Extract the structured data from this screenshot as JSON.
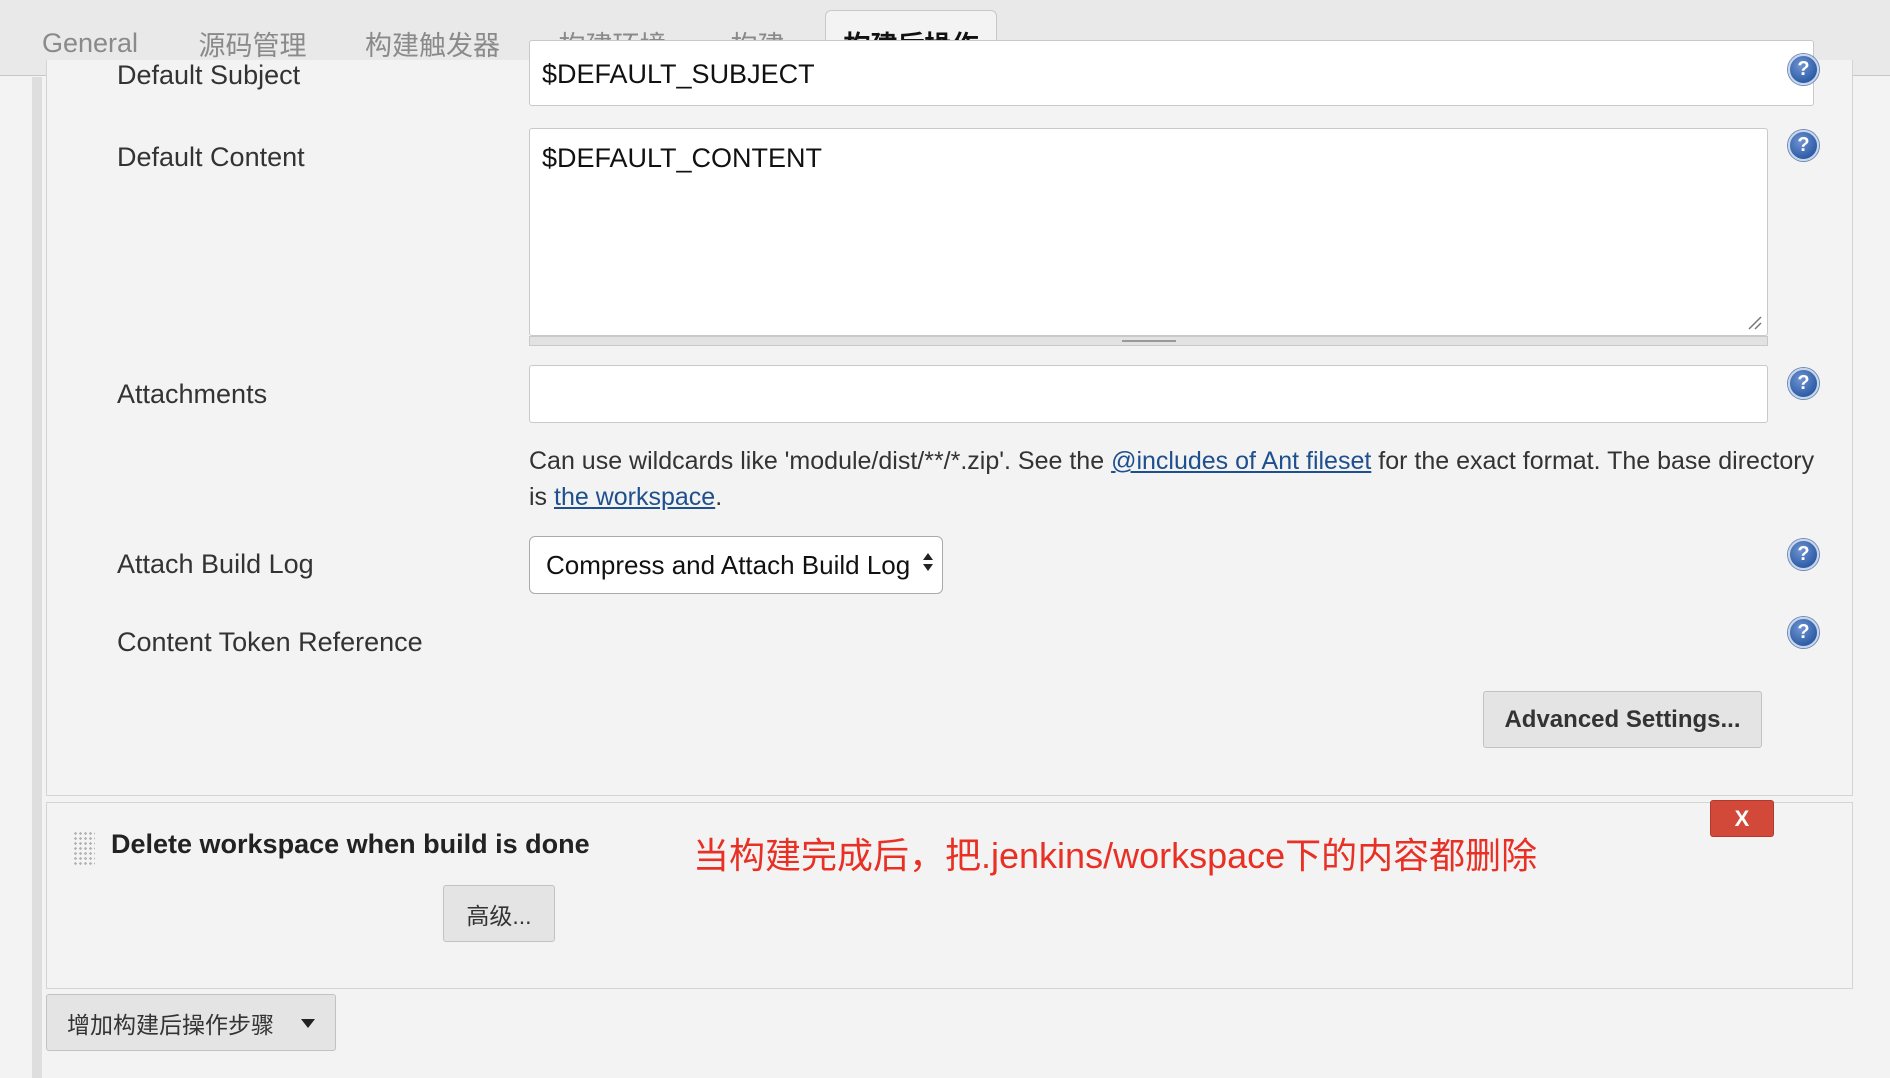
{
  "tabs": [
    {
      "label": "General",
      "active": false
    },
    {
      "label": "源码管理",
      "active": false
    },
    {
      "label": "构建触发器",
      "active": false
    },
    {
      "label": "构建环境",
      "active": false
    },
    {
      "label": "构建",
      "active": false
    },
    {
      "label": "构建后操作",
      "active": true
    }
  ],
  "email": {
    "default_subject_label": "Default Subject",
    "default_subject_value": "$DEFAULT_SUBJECT",
    "default_content_label": "Default Content",
    "default_content_value": "$DEFAULT_CONTENT",
    "attachments_label": "Attachments",
    "attachments_value": "",
    "attachments_hint_prefix": "Can use wildcards like 'module/dist/**/*.zip'. See the ",
    "attachments_hint_link": "@includes of Ant fileset",
    "attachments_hint_mid": " for the exact format. The base directory is ",
    "attachments_hint_link2": "the workspace",
    "attachments_hint_suffix": ".",
    "attach_build_log_label": "Attach Build Log",
    "attach_build_log_value": "Compress and Attach Build Log",
    "content_token_label": "Content Token Reference",
    "advanced_settings_button": "Advanced Settings..."
  },
  "delete_workspace": {
    "title": "Delete workspace when build is done",
    "advanced_button": "高级...",
    "remove_button": "X",
    "annotation": "当构建完成后，把.jenkins/workspace下的内容都删除"
  },
  "add_step_button": "增加构建后操作步骤",
  "colors": {
    "accent_link": "#1e4f8e",
    "remove_red": "#d24939",
    "annotation_red": "#e83025",
    "help_blue": "#2f5ea8"
  },
  "icons": [
    "help-icon",
    "drag-handle-icon",
    "dropdown-caret-icon",
    "select-arrows-icon",
    "resize-grip-icon"
  ]
}
